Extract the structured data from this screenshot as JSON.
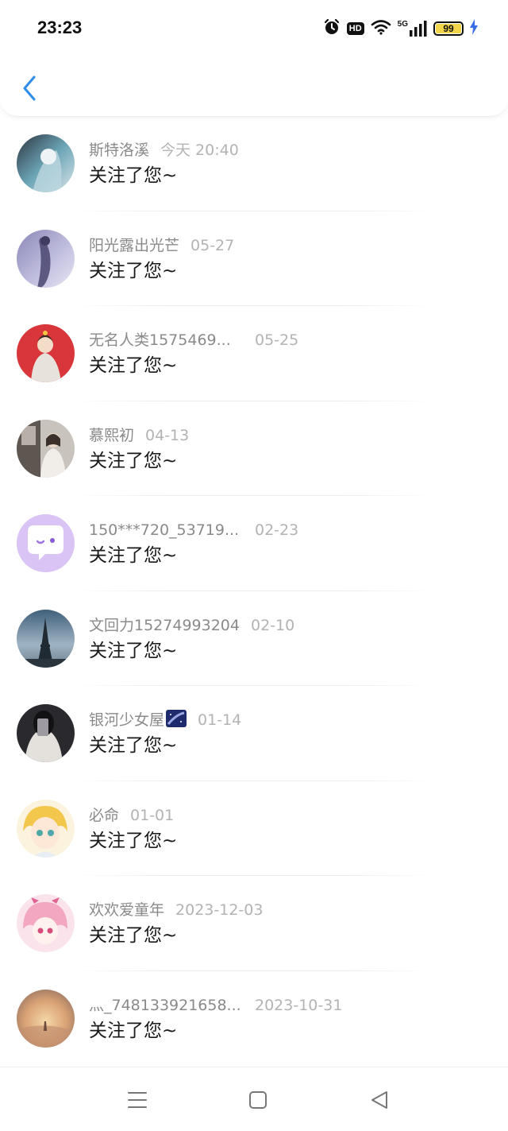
{
  "status_bar": {
    "time": "23:23",
    "hd_label": "HD",
    "network_label": "5G",
    "battery_level": "99",
    "battery_fraction": 0.99,
    "icons": [
      "alarm-icon",
      "hd-icon",
      "wifi-icon",
      "signal-icon",
      "battery-icon",
      "charging-icon"
    ]
  },
  "header": {
    "back_icon": "chevron-left-icon"
  },
  "notifications": [
    {
      "name": "斯特洛溪",
      "date": "今天 20:40",
      "message": "关注了您~"
    },
    {
      "name": "阳光露出光芒",
      "date": "05-27",
      "message": "关注了您~"
    },
    {
      "name": "无名人类1575469...",
      "date": "05-25",
      "message": "关注了您~"
    },
    {
      "name": "慕熙初",
      "date": "04-13",
      "message": "关注了您~"
    },
    {
      "name": "150***720_53719...",
      "date": "02-23",
      "message": "关注了您~"
    },
    {
      "name": "文回力15274993204",
      "date": "02-10",
      "message": "关注了您~"
    },
    {
      "name": "银河少女屋",
      "date": "01-14",
      "message": "关注了您~"
    },
    {
      "name": "必命",
      "date": "01-01",
      "message": "关注了您~"
    },
    {
      "name": "欢欢爱童年",
      "date": "2023-12-03",
      "message": "关注了您~"
    },
    {
      "name": "灬_748133921658...",
      "date": "2023-10-31",
      "message": "关注了您~"
    }
  ],
  "nav_bar": {
    "icons": [
      "menu-icon",
      "home-square-icon",
      "back-triangle-icon"
    ]
  },
  "colors": {
    "accent": "#2f8ce8",
    "name_text": "#8a8a8a",
    "date_text": "#b3b3b3",
    "message_text": "#1a1a1a",
    "battery": "#f2d548",
    "charging": "#3b6ee6"
  }
}
